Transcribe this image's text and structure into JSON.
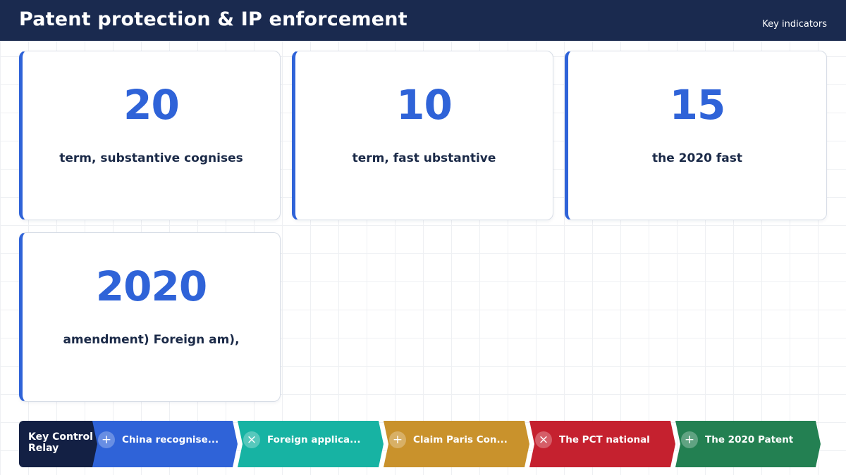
{
  "header": {
    "title": "Patent protection & IP enforcement",
    "subtitle": "Key indicators"
  },
  "cards": [
    {
      "value": "20",
      "label": "term, substantive cognises"
    },
    {
      "value": "10",
      "label": "term, fast ubstantive"
    },
    {
      "value": "15",
      "label": "the 2020 fast"
    },
    {
      "value": "2020",
      "label": "amendment) Foreign am),"
    }
  ],
  "relay": {
    "title": "Key Control Relay",
    "steps": [
      {
        "icon": "+",
        "icon_name": "plus-icon",
        "label": "China recognise...",
        "color": "#2f63d8"
      },
      {
        "icon": "×",
        "icon_name": "x-icon",
        "label": "Foreign applica...",
        "color": "#17b3a3"
      },
      {
        "icon": "+",
        "icon_name": "plus-icon",
        "label": "Claim Paris Con...",
        "color": "#c9922c"
      },
      {
        "icon": "×",
        "icon_name": "x-icon",
        "label": "The PCT national",
        "color": "#c5212f"
      },
      {
        "icon": "+",
        "icon_name": "plus-icon",
        "label": "The 2020 Patent",
        "color": "#238052"
      }
    ]
  },
  "colors": {
    "header_bg": "#1a2a4f",
    "accent": "#2f63d8",
    "relay_head_bg": "#132044"
  }
}
